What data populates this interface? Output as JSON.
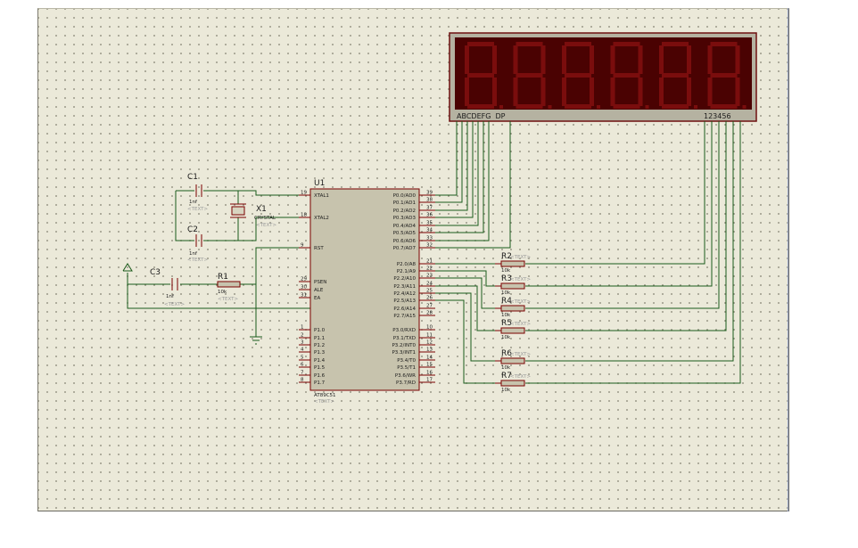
{
  "display": {
    "segment_label": "ABCDEFG  DP",
    "digit_label": "123456",
    "digits": 6
  },
  "mcu": {
    "ref": "U1",
    "part": "AT89C51",
    "text": "<TEXT>",
    "left_pins": [
      {
        "num": "19",
        "name": "XTAL1"
      },
      {
        "num": "18",
        "name": "XTAL2"
      },
      {
        "num": "9",
        "name": "RST"
      },
      {
        "num": "29",
        "name": "PSEN"
      },
      {
        "num": "30",
        "name": "ALE"
      },
      {
        "num": "31",
        "name": "EA"
      },
      {
        "num": "1",
        "name": "P1.0"
      },
      {
        "num": "2",
        "name": "P1.1"
      },
      {
        "num": "3",
        "name": "P1.2"
      },
      {
        "num": "4",
        "name": "P1.3"
      },
      {
        "num": "5",
        "name": "P1.4"
      },
      {
        "num": "6",
        "name": "P1.5"
      },
      {
        "num": "7",
        "name": "P1.6"
      },
      {
        "num": "8",
        "name": "P1.7"
      }
    ],
    "right_pins": [
      {
        "num": "39",
        "name": "P0.0/AD0"
      },
      {
        "num": "38",
        "name": "P0.1/AD1"
      },
      {
        "num": "37",
        "name": "P0.2/AD2"
      },
      {
        "num": "36",
        "name": "P0.3/AD3"
      },
      {
        "num": "35",
        "name": "P0.4/AD4"
      },
      {
        "num": "34",
        "name": "P0.5/AD5"
      },
      {
        "num": "33",
        "name": "P0.6/AD6"
      },
      {
        "num": "32",
        "name": "P0.7/AD7"
      },
      {
        "num": "21",
        "name": "P2.0/A8"
      },
      {
        "num": "22",
        "name": "P2.1/A9"
      },
      {
        "num": "23",
        "name": "P2.2/A10"
      },
      {
        "num": "24",
        "name": "P2.3/A11"
      },
      {
        "num": "25",
        "name": "P2.4/A12"
      },
      {
        "num": "26",
        "name": "P2.5/A13"
      },
      {
        "num": "27",
        "name": "P2.6/A14"
      },
      {
        "num": "28",
        "name": "P2.7/A15"
      },
      {
        "num": "10",
        "name": "P3.0/RXD"
      },
      {
        "num": "11",
        "name": "P3.1/TXD"
      },
      {
        "num": "12",
        "name": "P3.2/INT0"
      },
      {
        "num": "13",
        "name": "P3.3/INT1"
      },
      {
        "num": "14",
        "name": "P3.4/T0"
      },
      {
        "num": "15",
        "name": "P3.5/T1"
      },
      {
        "num": "16",
        "name": "P3.6/WR"
      },
      {
        "num": "17",
        "name": "P3.7/RD"
      }
    ]
  },
  "components": {
    "c1": {
      "ref": "C1",
      "value": "1nf",
      "text": "<TEXT>"
    },
    "c2": {
      "ref": "C2",
      "value": "1nf",
      "text": "<TEXT>"
    },
    "c3": {
      "ref": "C3",
      "value": "1nf",
      "text": "<TEXT>"
    },
    "x1": {
      "ref": "X1",
      "value": "CRYSTAL",
      "text": "<TEXT>"
    },
    "r1": {
      "ref": "R1",
      "value": "10k",
      "text": "<TEXT>"
    },
    "resistors": [
      {
        "ref": "R2",
        "value": "10k",
        "text": "<TEXT>"
      },
      {
        "ref": "R3",
        "value": "10k",
        "text": "<TEXT>"
      },
      {
        "ref": "R4",
        "value": "10k",
        "text": "<TEXT>"
      },
      {
        "ref": "R5",
        "value": "10k",
        "text": "<TEXT>"
      },
      {
        "ref": "R6",
        "value": "10k",
        "text": "<TEXT>"
      },
      {
        "ref": "R7",
        "value": "10k",
        "text": "<TEXT>"
      }
    ]
  },
  "colors": {
    "wire": "#1a5a1a",
    "pin": "#7a0000",
    "body": "#c7c3ad",
    "display_bg": "#4a0202",
    "segment": "#7a0d0d"
  }
}
